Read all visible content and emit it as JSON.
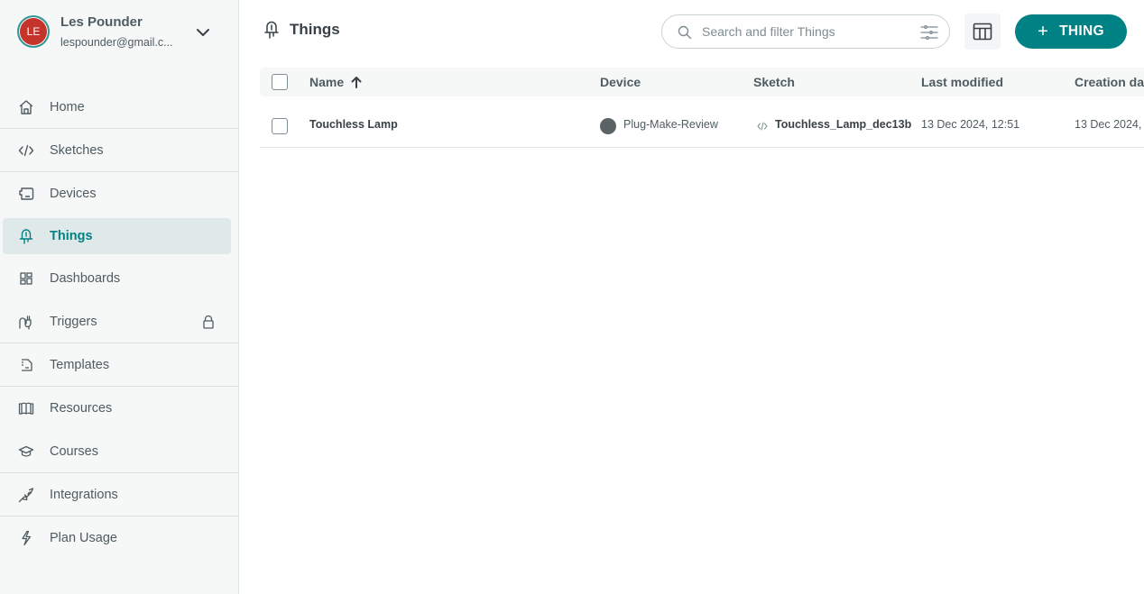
{
  "user": {
    "initials": "LE",
    "name": "Les Pounder",
    "email": "lespounder@gmail.c..."
  },
  "sidebar": {
    "items": [
      {
        "label": "Home",
        "icon": "home-icon"
      },
      {
        "label": "Sketches",
        "icon": "code-icon"
      },
      {
        "label": "Devices",
        "icon": "device-icon"
      },
      {
        "label": "Things",
        "icon": "led-icon",
        "active": true
      },
      {
        "label": "Dashboards",
        "icon": "dashboard-icon"
      },
      {
        "label": "Triggers",
        "icon": "plug-icon",
        "locked": true
      },
      {
        "label": "Templates",
        "icon": "template-icon"
      },
      {
        "label": "Resources",
        "icon": "book-icon"
      },
      {
        "label": "Courses",
        "icon": "graduation-cap-icon"
      },
      {
        "label": "Integrations",
        "icon": "connector-icon"
      },
      {
        "label": "Plan Usage",
        "icon": "lightning-icon"
      }
    ]
  },
  "header": {
    "title": "Things",
    "search_placeholder": "Search and filter Things",
    "add_button_label": "THING"
  },
  "table": {
    "columns": [
      "Name",
      "Device",
      "Sketch",
      "Last modified",
      "Creation da"
    ],
    "sort": {
      "column": "Name",
      "direction": "ascending"
    },
    "rows": [
      {
        "name": "Touchless Lamp",
        "device": "Plug-Make-Review",
        "device_status": "offline",
        "sketch": "Touchless_Lamp_dec13b",
        "last_modified": "13 Dec 2024, 12:51",
        "creation_date": "13 Dec 2024,"
      }
    ]
  },
  "colors": {
    "accent": "#008184",
    "avatar_bg": "#c4342b",
    "sidebar_bg": "#f6f8f8",
    "active_bg": "#dfe9ea",
    "device_offline": "#5c6367"
  }
}
